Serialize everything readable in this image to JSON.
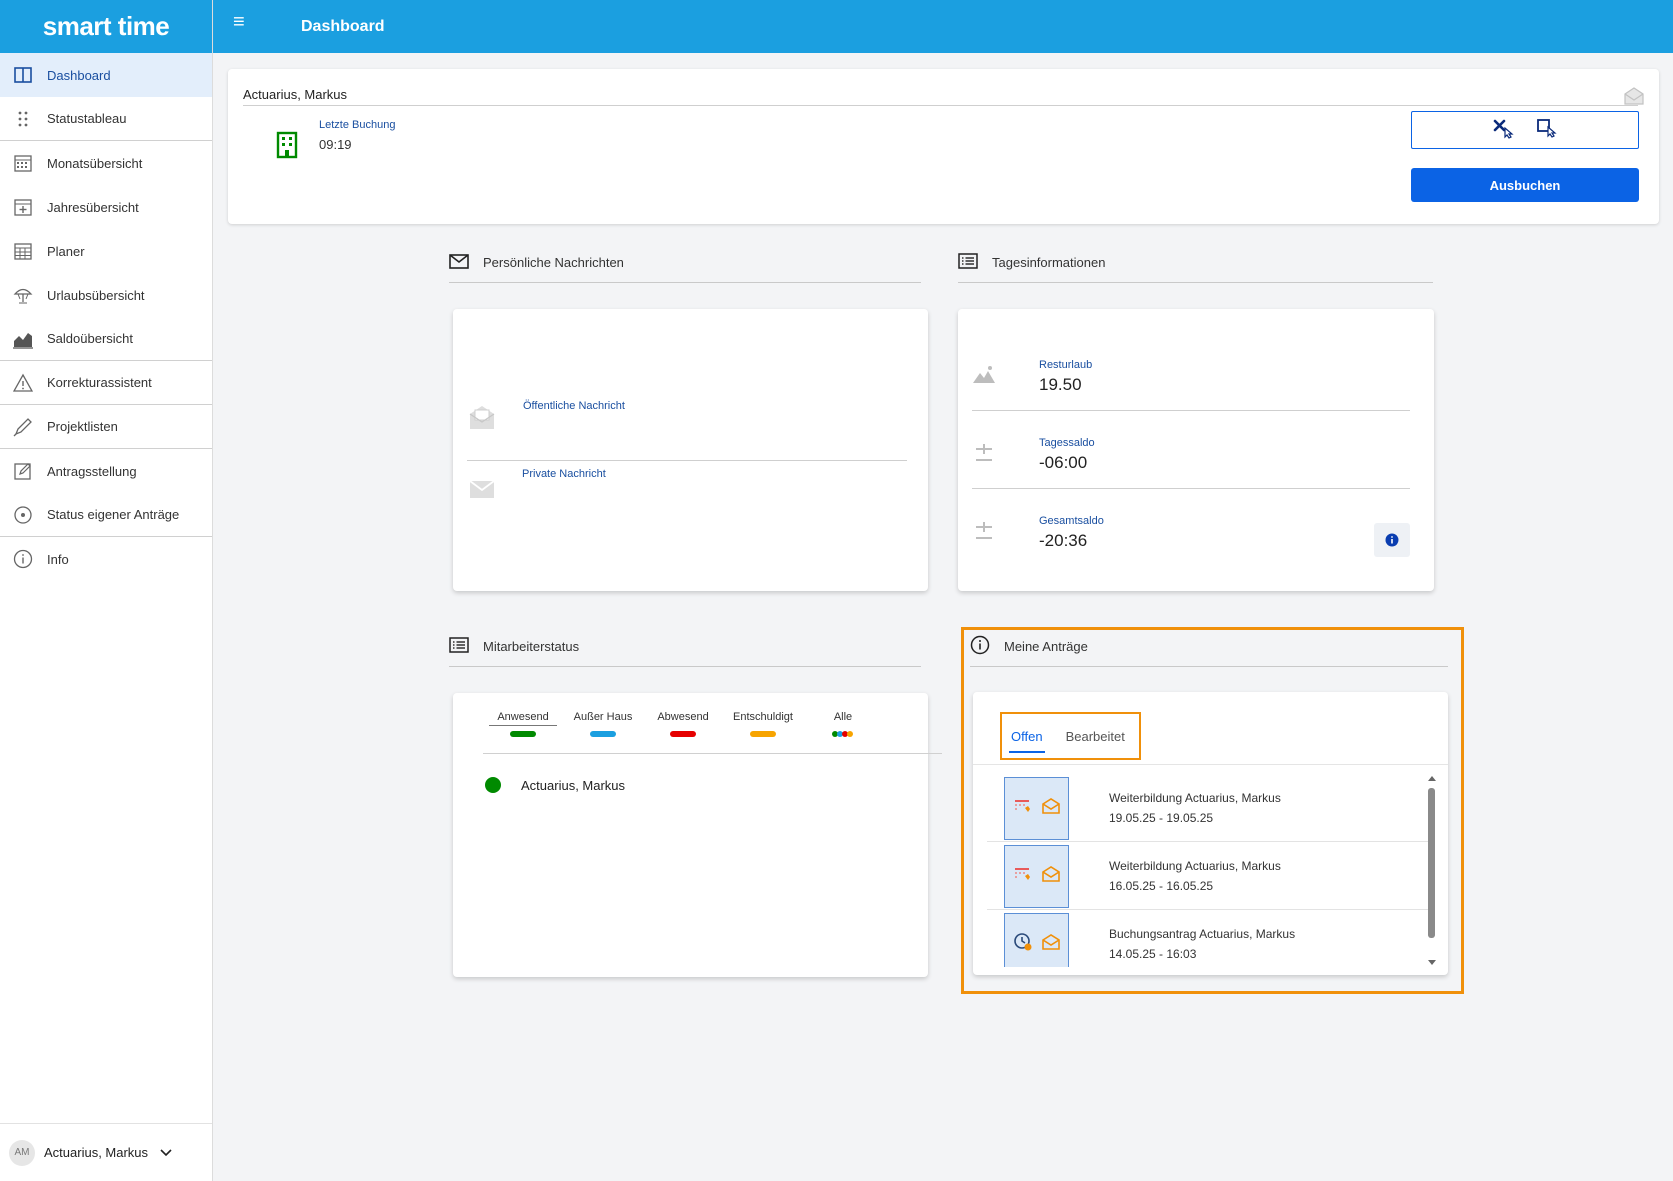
{
  "app": {
    "logo": "smart time",
    "page_title": "Dashboard"
  },
  "sidebar": {
    "items": [
      {
        "label": "Dashboard",
        "icon": "book-open-icon"
      },
      {
        "label": "Statustableau",
        "icon": "dots-grid-icon"
      },
      {
        "label": "Monatsübersicht",
        "icon": "calendar-icon"
      },
      {
        "label": "Jahresübersicht",
        "icon": "calendar-plus-icon"
      },
      {
        "label": "Planer",
        "icon": "calendar-grid-icon"
      },
      {
        "label": "Urlaubsübersicht",
        "icon": "umbrella-icon"
      },
      {
        "label": "Saldoübersicht",
        "icon": "area-chart-icon"
      },
      {
        "label": "Korrekturassistent",
        "icon": "warning-icon"
      },
      {
        "label": "Projektlisten",
        "icon": "pen-icon"
      },
      {
        "label": "Antragsstellung",
        "icon": "edit-icon"
      },
      {
        "label": "Status eigener Anträge",
        "icon": "target-icon"
      },
      {
        "label": "Info",
        "icon": "info-icon"
      }
    ],
    "user": {
      "initials": "AM",
      "name": "Actuarius, Markus"
    }
  },
  "top_card": {
    "name": "Actuarius, Markus",
    "last_booking_label": "Letzte Buchung",
    "last_booking_time": "09:19",
    "clock_out_label": "Ausbuchen"
  },
  "messages": {
    "title": "Persönliche Nachrichten",
    "public_label": "Öffentliche Nachricht",
    "private_label": "Private Nachricht"
  },
  "day_info": {
    "title": "Tagesinformationen",
    "rows": [
      {
        "label": "Resturlaub",
        "value": "19.50"
      },
      {
        "label": "Tagessaldo",
        "value": "-06:00"
      },
      {
        "label": "Gesamtsaldo",
        "value": "-20:36"
      }
    ]
  },
  "employee_status": {
    "title": "Mitarbeiterstatus",
    "filters": [
      {
        "label": "Anwesend",
        "color": "#008a00"
      },
      {
        "label": "Außer Haus",
        "color": "#1b9fe0"
      },
      {
        "label": "Abwesend",
        "color": "#e60000"
      },
      {
        "label": "Entschuldigt",
        "color": "#f7a400"
      },
      {
        "label": "Alle"
      }
    ],
    "employees": [
      {
        "name": "Actuarius, Markus",
        "status_color": "#008a00"
      }
    ]
  },
  "requests": {
    "title": "Meine Anträge",
    "tabs": [
      {
        "label": "Offen"
      },
      {
        "label": "Bearbeitet"
      }
    ],
    "items": [
      {
        "title": "Weiterbildung Actuarius, Markus",
        "date": "19.05.25 - 19.05.25",
        "icon": "calendar-training-icon"
      },
      {
        "title": "Weiterbildung Actuarius, Markus",
        "date": "16.05.25 - 16.05.25",
        "icon": "calendar-training-icon"
      },
      {
        "title": "Buchungsantrag Actuarius, Markus",
        "date": "14.05.25 - 16:03",
        "icon": "clock-icon"
      }
    ]
  },
  "colors": {
    "header": "#1b9fe0",
    "primary": "#0b63e5",
    "highlight": "#f0900a"
  }
}
